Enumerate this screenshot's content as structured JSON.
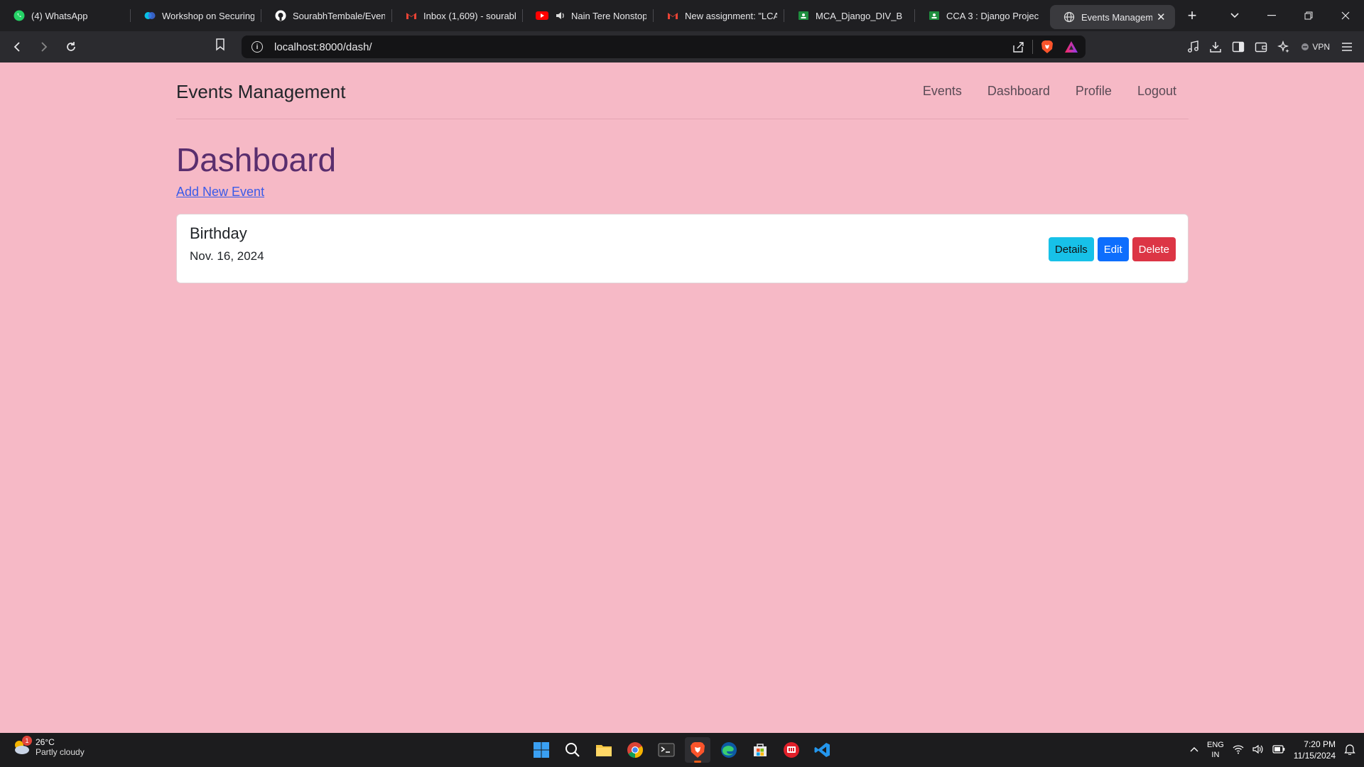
{
  "browser": {
    "tabs": [
      {
        "title": "(4) WhatsApp",
        "icon": "whatsapp-icon"
      },
      {
        "title": "Workshop on Securing",
        "icon": "webex-icon"
      },
      {
        "title": "SourabhTembale/Even",
        "icon": "github-icon"
      },
      {
        "title": "Inbox (1,609) - sourabl",
        "icon": "gmail-icon"
      },
      {
        "title": "Nain Tere Nonstop",
        "icon": "youtube-icon"
      },
      {
        "title": "New assignment: \"LCA",
        "icon": "gmail-icon"
      },
      {
        "title": "MCA_Django_DIV_B",
        "icon": "classroom-icon"
      },
      {
        "title": "CCA 3 : Django Projec",
        "icon": "classroom-icon"
      },
      {
        "title": "Events Manageme",
        "icon": "globe-icon",
        "active": true
      }
    ],
    "url": "localhost:8000/dash/",
    "vpn_label": "VPN"
  },
  "page": {
    "brand": "Events Management",
    "nav": [
      "Events",
      "Dashboard",
      "Profile",
      "Logout"
    ],
    "title": "Dashboard",
    "add_link": "Add New Event",
    "events": [
      {
        "name": "Birthday",
        "date": "Nov. 16, 2024",
        "details_label": "Details",
        "edit_label": "Edit",
        "delete_label": "Delete"
      }
    ]
  },
  "taskbar": {
    "weather_temp": "26°C",
    "weather_cond": "Partly cloudy",
    "weather_badge": "1",
    "lang_line1": "ENG",
    "lang_line2": "IN",
    "time": "7:20 PM",
    "date": "11/15/2024"
  },
  "colors": {
    "page_bg": "#f6b9c6",
    "title": "#5a2e6e",
    "link": "#3a5be8",
    "details": "#17c1e8",
    "edit": "#0d6efd",
    "delete": "#dc3545"
  }
}
